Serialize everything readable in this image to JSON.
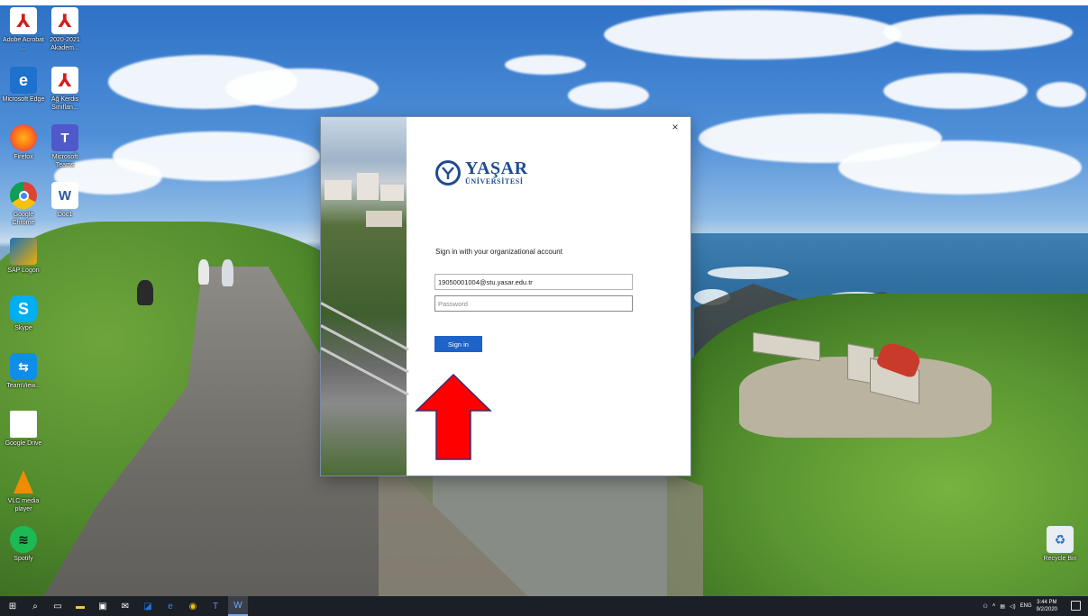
{
  "desktop": {
    "icons": [
      {
        "label": "Adobe Acrobat ..."
      },
      {
        "label": "2020-2021 Akadem..."
      },
      {
        "label": "Microsoft Edge"
      },
      {
        "label": "Ağ Kerdis Sınıflan..."
      },
      {
        "label": "Firefox"
      },
      {
        "label": "Microsoft Teams"
      },
      {
        "label": "Google Chrome"
      },
      {
        "label": "Doc1"
      },
      {
        "label": "SAP Logon"
      },
      {
        "label": "Skype"
      },
      {
        "label": "TeamView..."
      },
      {
        "label": "Google Drive"
      },
      {
        "label": "VLC media player"
      },
      {
        "label": "Spotify"
      },
      {
        "label": "Recycle Bin"
      }
    ]
  },
  "dialog": {
    "close_glyph": "×",
    "logo": {
      "line1": "YAŞAR",
      "line2": "ÜNİVERSİTESİ"
    },
    "prompt": "Sign in with your organizational account",
    "email_value": "19050001004@stu.yasar.edu.tr",
    "password_placeholder": "Password",
    "signin_label": "Sign in"
  },
  "annotation": {
    "arrow_color": "#ff0000"
  },
  "taskbar": {
    "apps": [
      "start-icon",
      "search-icon",
      "task-view-icon",
      "file-explorer-icon",
      "store-icon",
      "mail-icon",
      "outlook-icon",
      "edge-icon",
      "chrome-icon",
      "teams-icon",
      "word-icon"
    ],
    "tray": {
      "language": "ENG",
      "time": "3:44 PM",
      "date": "9/2/2020"
    }
  }
}
